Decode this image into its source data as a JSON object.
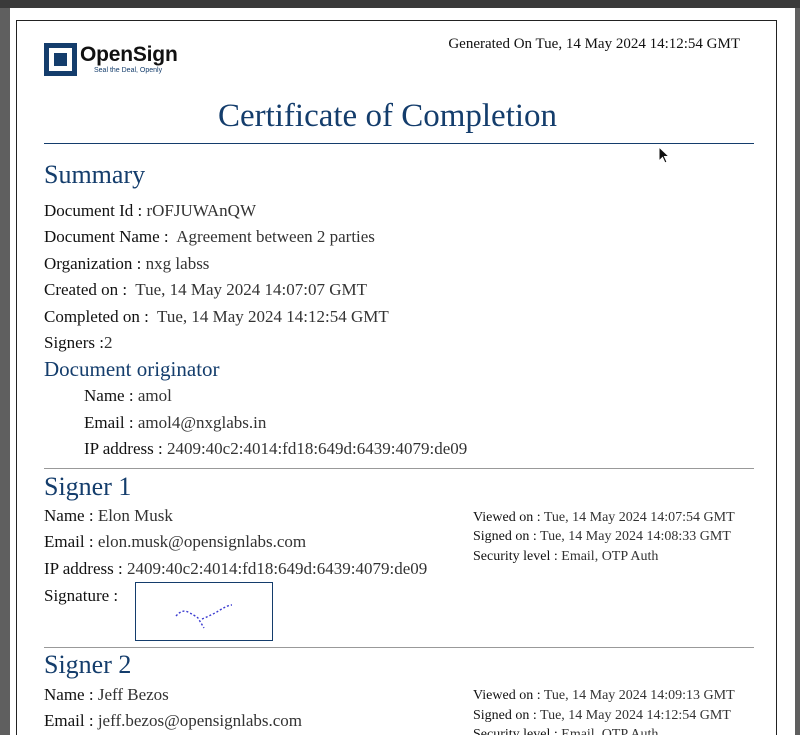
{
  "brand": {
    "name": "OpenSign",
    "tagline": "Seal the Deal, Openly"
  },
  "generated": "Generated On Tue, 14 May 2024 14:12:54 GMT",
  "title": "Certificate of Completion",
  "summary": {
    "heading": "Summary",
    "doc_id_label": "Document Id :",
    "doc_id": "rOFJUWAnQW",
    "doc_name_label": "Document Name :",
    "doc_name": "Agreement between 2 parties",
    "org_label": "Organization :",
    "org": "nxg labss",
    "created_label": "Created on :",
    "created": "Tue, 14 May 2024 14:07:07 GMT",
    "completed_label": "Completed on :",
    "completed": "Tue, 14 May 2024 14:12:54 GMT",
    "signers_label": "Signers :",
    "signers": "2"
  },
  "originator": {
    "heading": "Document originator",
    "name_label": "Name :",
    "name": "amol",
    "email_label": "Email :",
    "email": "amol4@nxglabs.in",
    "ip_label": "IP address :",
    "ip": "2409:40c2:4014:fd18:649d:6439:4079:de09"
  },
  "signer1": {
    "heading": "Signer 1",
    "name_label": "Name :",
    "name": "Elon Musk",
    "email_label": "Email :",
    "email": "elon.musk@opensignlabs.com",
    "ip_label": "IP address :",
    "ip": "2409:40c2:4014:fd18:649d:6439:4079:de09",
    "signature_label": "Signature :",
    "viewed_label": "Viewed on :",
    "viewed": "Tue, 14 May 2024 14:07:54 GMT",
    "signed_label": "Signed on :",
    "signed": "Tue, 14 May 2024 14:08:33 GMT",
    "security_label": "Security level :",
    "security": "Email, OTP Auth"
  },
  "signer2": {
    "heading": "Signer 2",
    "name_label": "Name :",
    "name": "Jeff Bezos",
    "email_label": "Email :",
    "email": "jeff.bezos@opensignlabs.com",
    "viewed_label": "Viewed on :",
    "viewed": "Tue, 14 May 2024 14:09:13 GMT",
    "signed_label": "Signed on :",
    "signed": "Tue, 14 May 2024 14:12:54 GMT",
    "security_label": "Security level :",
    "security": "Email, OTP Auth"
  },
  "colors": {
    "accent": "#143d6c",
    "text": "#111111"
  }
}
